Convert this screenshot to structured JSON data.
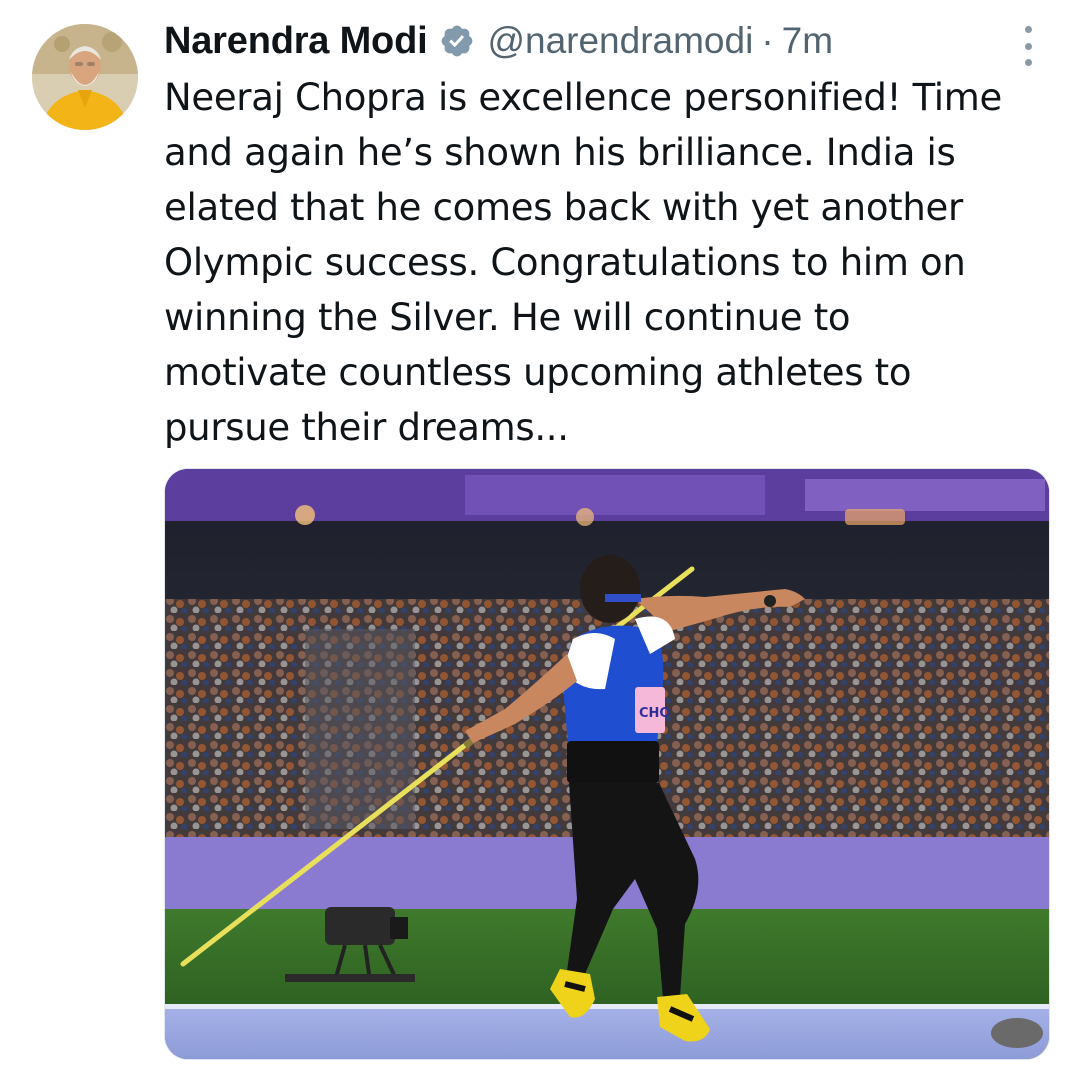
{
  "tweet": {
    "author": {
      "display_name": "Narendra Modi",
      "handle": "@narendramodi",
      "verified": true,
      "avatar_icon": "profile-photo"
    },
    "separator": "·",
    "time": "7m",
    "more_icon": "more-vertical-icon",
    "text": "Neeraj Chopra is excellence personified! Time\nand again he’s shown his brilliance. India is\nelated that he comes back with yet another\nOlympic success. Congratulations to him on\nwinning the Silver. He will continue to\nmotivate countless upcoming athletes to\npursue their dreams...",
    "media": {
      "type": "photo",
      "bib_text": "CHO"
    }
  },
  "colors": {
    "text": "#0f1419",
    "secondary": "#536471",
    "verified_badge": "#829aab",
    "background": "#ffffff"
  }
}
